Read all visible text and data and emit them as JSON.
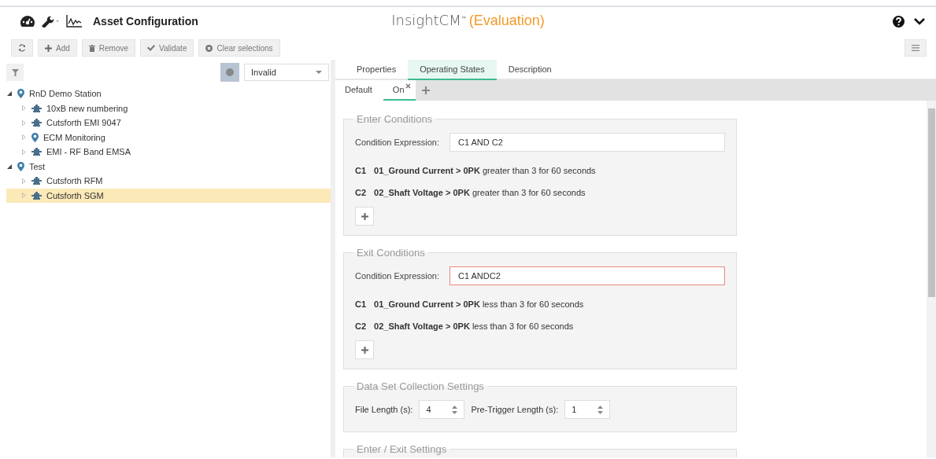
{
  "header": {
    "title": "Asset Configuration",
    "brand": "InsightCM$^{™}$",
    "edition": "(Evaluation)"
  },
  "toolbar": [
    {
      "kind": "refresh"
    },
    {
      "kind": "add",
      "label": "Add"
    },
    {
      "kind": "remove",
      "label": "Remove"
    },
    {
      "kind": "validate",
      "label": "Validate"
    },
    {
      "kind": "clear",
      "label": "Clear selections"
    }
  ],
  "status_filter": {
    "value": "Invalid"
  },
  "tree": [
    {
      "label": "RnD Demo Station",
      "kind": "location",
      "expanded": true,
      "selected": false,
      "children": [
        {
          "label": "10xB new numbering",
          "kind": "asset",
          "expanded": false,
          "selected": false
        },
        {
          "label": "Cutsforth EMI 9047",
          "kind": "asset",
          "expanded": false,
          "selected": false
        },
        {
          "label": "ECM Monitoring",
          "kind": "location",
          "expanded": false,
          "selected": false
        },
        {
          "label": "EMI - RF Band EMSA",
          "kind": "asset",
          "expanded": false,
          "selected": false
        }
      ]
    },
    {
      "label": "Test",
      "kind": "location",
      "expanded": true,
      "selected": false,
      "children": [
        {
          "label": "Cutsforth RFM",
          "kind": "asset",
          "expanded": false,
          "selected": false
        },
        {
          "label": "Cutsforth SGM",
          "kind": "asset",
          "expanded": false,
          "selected": true
        }
      ]
    }
  ],
  "tabs": [
    {
      "label": "Properties",
      "selected": false
    },
    {
      "label": "Operating States",
      "selected": true
    },
    {
      "label": "Description",
      "selected": false
    }
  ],
  "state_tabs": [
    {
      "label": "Default",
      "selected": false,
      "closable": false
    },
    {
      "label": "On",
      "selected": true,
      "closable": true
    }
  ],
  "sections": [
    {
      "kind": "conditions",
      "title": "Enter Conditions",
      "expression_label": "Condition Expression:",
      "expression": "C1 AND C2",
      "invalid": false,
      "conditions": [
        {
          "id": "C1",
          "text": "**01_Ground Current > 0PK** greater than 3 for 60 seconds"
        },
        {
          "id": "C2",
          "text": "**02_Shaft Voltage > 0PK** greater than 3 for 60 seconds"
        }
      ]
    },
    {
      "kind": "conditions",
      "title": "Exit Conditions",
      "expression_label": "Condition Expression:",
      "expression": "C1 ANDC2",
      "invalid": true,
      "conditions": [
        {
          "id": "C1",
          "text": "**01_Ground Current > 0PK** less than 3 for 60 seconds"
        },
        {
          "id": "C2",
          "text": "**02_Shaft Voltage > 0PK** less than 3 for 60 seconds"
        }
      ]
    },
    {
      "kind": "settings",
      "title": "Data Set Collection Settings",
      "fields": [
        {
          "label": "File Length (s):",
          "value": "4"
        },
        {
          "label": "Pre-Trigger Length (s):",
          "value": "1"
        }
      ]
    },
    {
      "kind": "empty",
      "title": "Enter / Exit Settings"
    }
  ]
}
